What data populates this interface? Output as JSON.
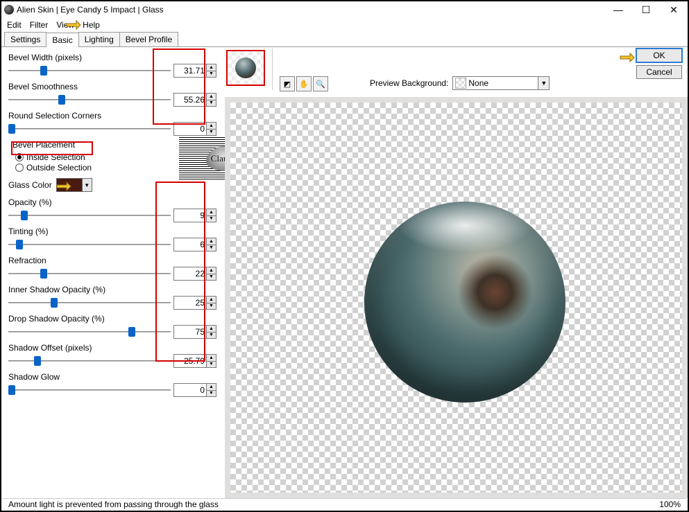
{
  "window": {
    "title": "Alien Skin | Eye Candy 5 Impact | Glass"
  },
  "menus": {
    "edit": "Edit",
    "filter": "Filter",
    "view": "View",
    "help": "Help"
  },
  "tabs": {
    "settings": "Settings",
    "basic": "Basic",
    "lighting": "Lighting",
    "bevel": "Bevel Profile"
  },
  "params": {
    "bevel_width": {
      "label": "Bevel Width (pixels)",
      "value": "31.71",
      "pct": 22
    },
    "bevel_smooth": {
      "label": "Bevel Smoothness",
      "value": "55.26",
      "pct": 33
    },
    "round_corners": {
      "label": "Round Selection Corners",
      "value": "0",
      "pct": 2
    },
    "placement": {
      "label": "Bevel Placement",
      "inside": "Inside Selection",
      "outside": "Outside Selection"
    },
    "glass_color": {
      "label": "Glass Color"
    },
    "opacity": {
      "label": "Opacity (%)",
      "value": "9",
      "pct": 10
    },
    "tinting": {
      "label": "Tinting (%)",
      "value": "6",
      "pct": 7
    },
    "refraction": {
      "label": "Refraction",
      "value": "22",
      "pct": 22
    },
    "inner_shadow": {
      "label": "Inner Shadow Opacity (%)",
      "value": "25",
      "pct": 28
    },
    "drop_shadow": {
      "label": "Drop Shadow Opacity (%)",
      "value": "75",
      "pct": 76
    },
    "shadow_offset": {
      "label": "Shadow Offset (pixels)",
      "value": "25.79",
      "pct": 18
    },
    "shadow_glow": {
      "label": "Shadow Glow",
      "value": "0",
      "pct": 2
    }
  },
  "preview": {
    "bg_label": "Preview Background:",
    "bg_value": "None"
  },
  "buttons": {
    "ok": "OK",
    "cancel": "Cancel"
  },
  "status": {
    "hint": "Amount light is prevented from passing through the glass",
    "zoom": "100%"
  },
  "watermark": "Claudia"
}
